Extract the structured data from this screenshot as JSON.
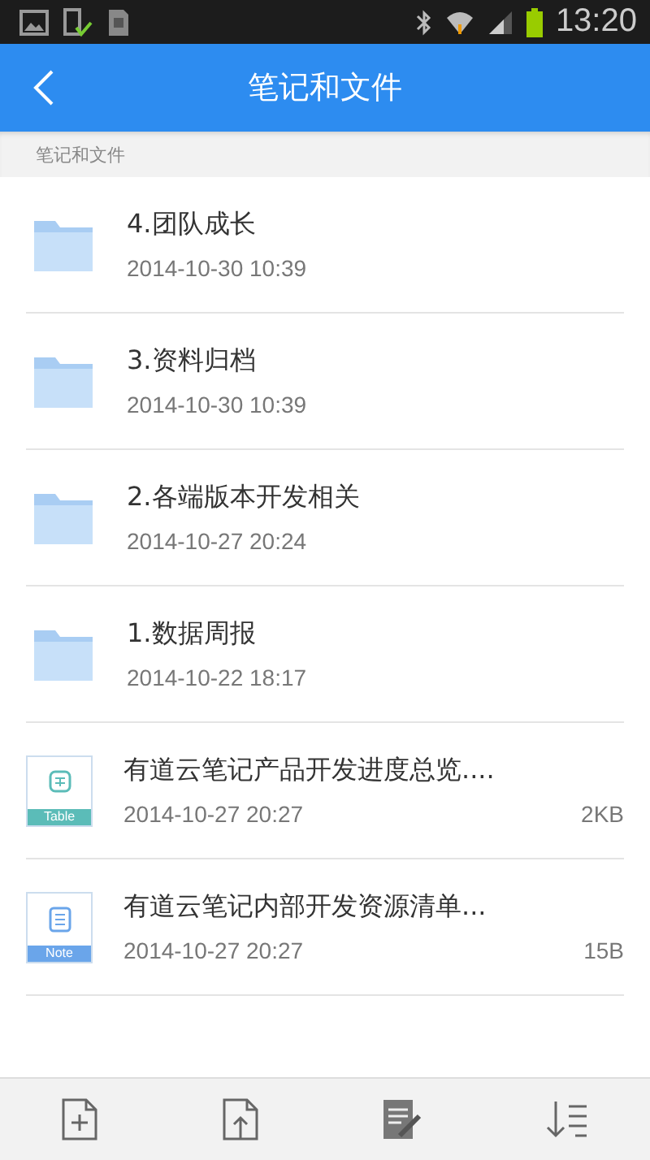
{
  "status_bar": {
    "time": "13:20"
  },
  "header": {
    "title": "笔记和文件"
  },
  "breadcrumb": "笔记和文件",
  "items": [
    {
      "kind": "folder",
      "title": "4.团队成长",
      "date": "2014-10-30 10:39"
    },
    {
      "kind": "folder",
      "title": "3.资料归档",
      "date": "2014-10-30 10:39"
    },
    {
      "kind": "folder",
      "title": "2.各端版本开发相关",
      "date": "2014-10-27 20:24"
    },
    {
      "kind": "folder",
      "title": "1.数据周报",
      "date": "2014-10-22 18:17"
    },
    {
      "kind": "table",
      "badge": "Table",
      "title": "有道云笔记产品开发进度总览....",
      "date": "2014-10-27 20:27",
      "size": "2KB"
    },
    {
      "kind": "note",
      "badge": "Note",
      "title": "有道云笔记内部开发资源清单...",
      "date": "2014-10-27 20:27",
      "size": "15B"
    }
  ]
}
